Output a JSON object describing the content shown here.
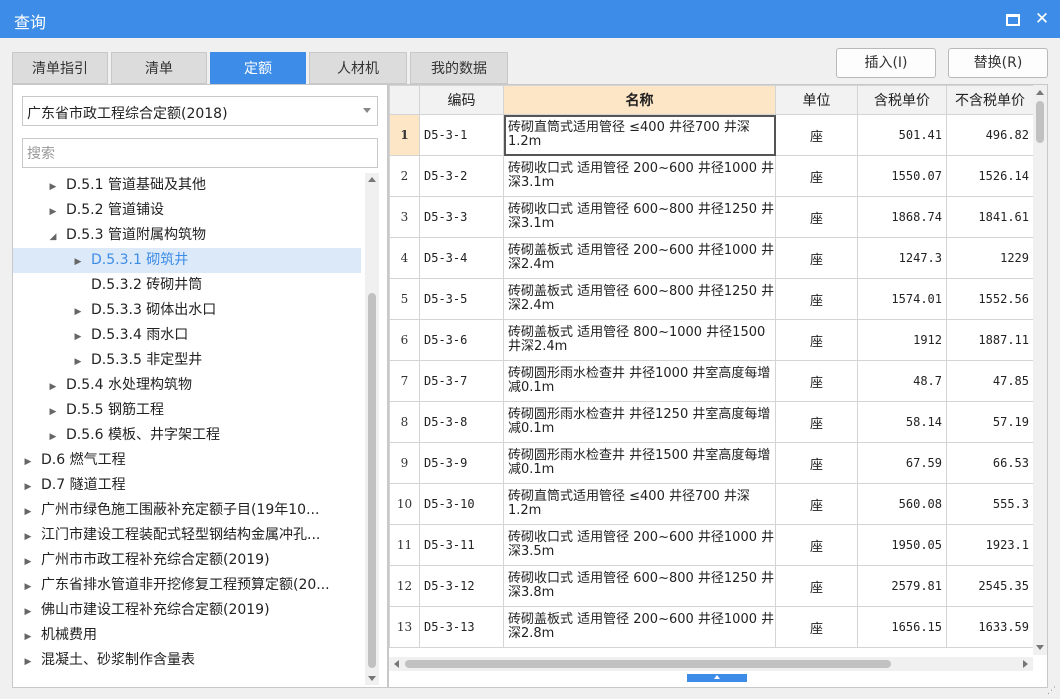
{
  "window": {
    "title": "查询",
    "maximize_icon": "maximize-icon",
    "close_glyph": "✕"
  },
  "tabs": [
    "清单指引",
    "清单",
    "定额",
    "人材机",
    "我的数据"
  ],
  "active_tab": "定额",
  "buttons": {
    "insert": "插入(I)",
    "replace": "替换(R)"
  },
  "left": {
    "library": "广东省市政工程综合定额(2018)",
    "search_placeholder": "搜索",
    "tree": [
      {
        "label": "D.5.1 管道基础及其他",
        "indent": 2,
        "arrow": "▶"
      },
      {
        "label": "D.5.2 管道铺设",
        "indent": 2,
        "arrow": "▶"
      },
      {
        "label": "D.5.3 管道附属构筑物",
        "indent": 2,
        "arrow": "◢"
      },
      {
        "label": "D.5.3.1 砌筑井",
        "indent": 3,
        "arrow": "▶",
        "selected": true
      },
      {
        "label": "D.5.3.2 砖砌井筒",
        "indent": 3,
        "arrow": ""
      },
      {
        "label": "D.5.3.3 砌体出水口",
        "indent": 3,
        "arrow": "▶"
      },
      {
        "label": "D.5.3.4 雨水口",
        "indent": 3,
        "arrow": "▶"
      },
      {
        "label": "D.5.3.5 非定型井",
        "indent": 3,
        "arrow": "▶"
      },
      {
        "label": "D.5.4 水处理构筑物",
        "indent": 2,
        "arrow": "▶"
      },
      {
        "label": "D.5.5 钢筋工程",
        "indent": 2,
        "arrow": "▶"
      },
      {
        "label": "D.5.6 模板、井字架工程",
        "indent": 2,
        "arrow": "▶"
      },
      {
        "label": "D.6 燃气工程",
        "indent": 1,
        "arrow": "▶"
      },
      {
        "label": "D.7 隧道工程",
        "indent": 1,
        "arrow": "▶"
      },
      {
        "label": "广州市绿色施工围蔽补充定额子目(19年10...",
        "indent": 1,
        "arrow": "▶"
      },
      {
        "label": "江门市建设工程装配式轻型钢结构金属冲孔...",
        "indent": 1,
        "arrow": "▶"
      },
      {
        "label": "广州市市政工程补充综合定额(2019)",
        "indent": 1,
        "arrow": "▶"
      },
      {
        "label": "广东省排水管道非开挖修复工程预算定额(20...",
        "indent": 1,
        "arrow": "▶"
      },
      {
        "label": "佛山市建设工程补充综合定额(2019)",
        "indent": 1,
        "arrow": "▶"
      },
      {
        "label": "机械费用",
        "indent": 1,
        "arrow": "▶"
      },
      {
        "label": "混凝土、砂浆制作含量表",
        "indent": 1,
        "arrow": "▶"
      }
    ]
  },
  "grid": {
    "headers": [
      "",
      "编码",
      "名称",
      "单位",
      "含税单价",
      "不含税单价"
    ],
    "rows": [
      {
        "idx": "1",
        "code": "D5-3-1",
        "name": "砖砌直筒式适用管径 ≤400 井径700 井深1.2m",
        "unit": "座",
        "tax": "501.41",
        "notax": "496.82"
      },
      {
        "idx": "2",
        "code": "D5-3-2",
        "name": "砖砌收口式 适用管径 200~600 井径1000 井深3.1m",
        "unit": "座",
        "tax": "1550.07",
        "notax": "1526.14"
      },
      {
        "idx": "3",
        "code": "D5-3-3",
        "name": "砖砌收口式 适用管径 600~800 井径1250 井深3.1m",
        "unit": "座",
        "tax": "1868.74",
        "notax": "1841.61"
      },
      {
        "idx": "4",
        "code": "D5-3-4",
        "name": "砖砌盖板式 适用管径 200~600 井径1000 井深2.4m",
        "unit": "座",
        "tax": "1247.3",
        "notax": "1229"
      },
      {
        "idx": "5",
        "code": "D5-3-5",
        "name": "砖砌盖板式 适用管径 600~800 井径1250 井深2.4m",
        "unit": "座",
        "tax": "1574.01",
        "notax": "1552.56"
      },
      {
        "idx": "6",
        "code": "D5-3-6",
        "name": "砖砌盖板式 适用管径 800~1000 井径1500 井深2.4m",
        "unit": "座",
        "tax": "1912",
        "notax": "1887.11"
      },
      {
        "idx": "7",
        "code": "D5-3-7",
        "name": "砖砌圆形雨水检查井 井径1000 井室高度每增减0.1m",
        "unit": "座",
        "tax": "48.7",
        "notax": "47.85"
      },
      {
        "idx": "8",
        "code": "D5-3-8",
        "name": "砖砌圆形雨水检查井 井径1250 井室高度每增减0.1m",
        "unit": "座",
        "tax": "58.14",
        "notax": "57.19"
      },
      {
        "idx": "9",
        "code": "D5-3-9",
        "name": "砖砌圆形雨水检查井 井径1500 井室高度每增减0.1m",
        "unit": "座",
        "tax": "67.59",
        "notax": "66.53"
      },
      {
        "idx": "10",
        "code": "D5-3-10",
        "name": "砖砌直筒式适用管径 ≤400 井径700 井深1.2m",
        "unit": "座",
        "tax": "560.08",
        "notax": "555.3"
      },
      {
        "idx": "11",
        "code": "D5-3-11",
        "name": "砖砌收口式 适用管径 200~600 井径1000 井深3.5m",
        "unit": "座",
        "tax": "1950.05",
        "notax": "1923.1"
      },
      {
        "idx": "12",
        "code": "D5-3-12",
        "name": "砖砌收口式 适用管径 600~800 井径1250 井深3.8m",
        "unit": "座",
        "tax": "2579.81",
        "notax": "2545.35"
      },
      {
        "idx": "13",
        "code": "D5-3-13",
        "name": "砖砌盖板式 适用管径 200~600 井径1000 井深2.8m",
        "unit": "座",
        "tax": "1656.15",
        "notax": "1633.59"
      }
    ]
  },
  "colors": {
    "accent": "#3d8de8",
    "selected_row_bg": "#fde6c6",
    "tree_selected_bg": "#dbe9f9"
  }
}
